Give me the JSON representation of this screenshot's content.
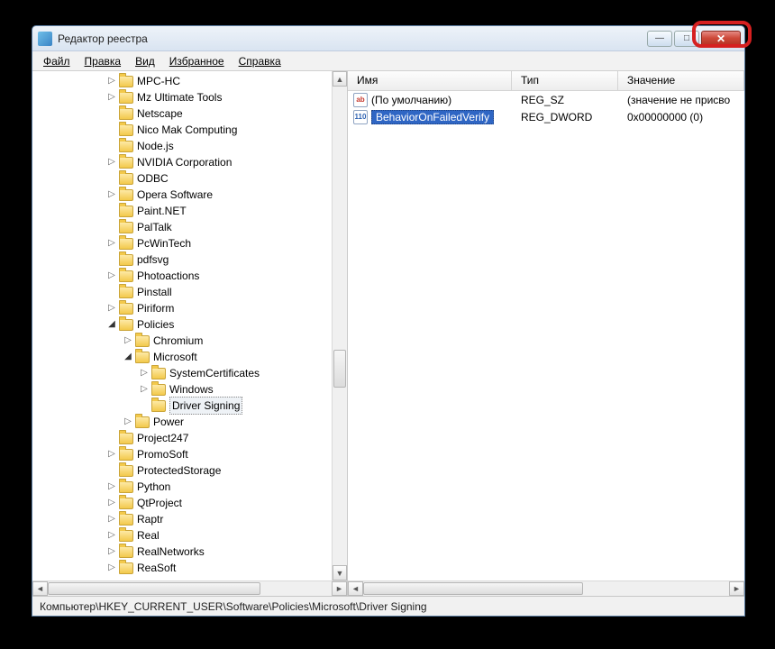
{
  "window": {
    "title": "Редактор реестра"
  },
  "menu": {
    "file": "Файл",
    "edit": "Правка",
    "view": "Вид",
    "favorites": "Избранное",
    "help": "Справка"
  },
  "tree": {
    "items": [
      {
        "depth": 0,
        "exp": "closed",
        "label": "MPC-HC"
      },
      {
        "depth": 0,
        "exp": "closed",
        "label": "Mz Ultimate Tools"
      },
      {
        "depth": 0,
        "exp": "none",
        "label": "Netscape"
      },
      {
        "depth": 0,
        "exp": "none",
        "label": "Nico Mak Computing"
      },
      {
        "depth": 0,
        "exp": "none",
        "label": "Node.js"
      },
      {
        "depth": 0,
        "exp": "closed",
        "label": "NVIDIA Corporation"
      },
      {
        "depth": 0,
        "exp": "none",
        "label": "ODBC"
      },
      {
        "depth": 0,
        "exp": "closed",
        "label": "Opera Software"
      },
      {
        "depth": 0,
        "exp": "none",
        "label": "Paint.NET"
      },
      {
        "depth": 0,
        "exp": "none",
        "label": "PalTalk"
      },
      {
        "depth": 0,
        "exp": "closed",
        "label": "PcWinTech"
      },
      {
        "depth": 0,
        "exp": "none",
        "label": "pdfsvg"
      },
      {
        "depth": 0,
        "exp": "closed",
        "label": "Photoactions"
      },
      {
        "depth": 0,
        "exp": "none",
        "label": "Pinstall"
      },
      {
        "depth": 0,
        "exp": "closed",
        "label": "Piriform"
      },
      {
        "depth": 0,
        "exp": "open",
        "label": "Policies"
      },
      {
        "depth": 1,
        "exp": "closed",
        "label": "Chromium"
      },
      {
        "depth": 1,
        "exp": "open",
        "label": "Microsoft"
      },
      {
        "depth": 2,
        "exp": "closed",
        "label": "SystemCertificates"
      },
      {
        "depth": 2,
        "exp": "closed",
        "label": "Windows"
      },
      {
        "depth": 2,
        "exp": "none",
        "label": "Driver Signing",
        "selected": true
      },
      {
        "depth": 1,
        "exp": "closed",
        "label": "Power"
      },
      {
        "depth": 0,
        "exp": "none",
        "label": "Project247"
      },
      {
        "depth": 0,
        "exp": "closed",
        "label": "PromoSoft"
      },
      {
        "depth": 0,
        "exp": "none",
        "label": "ProtectedStorage"
      },
      {
        "depth": 0,
        "exp": "closed",
        "label": "Python"
      },
      {
        "depth": 0,
        "exp": "closed",
        "label": "QtProject"
      },
      {
        "depth": 0,
        "exp": "closed",
        "label": "Raptr"
      },
      {
        "depth": 0,
        "exp": "closed",
        "label": "Real"
      },
      {
        "depth": 0,
        "exp": "closed",
        "label": "RealNetworks"
      },
      {
        "depth": 0,
        "exp": "closed",
        "label": "ReaSoft"
      }
    ]
  },
  "list": {
    "columns": {
      "name": "Имя",
      "type": "Тип",
      "value": "Значение"
    },
    "rows": [
      {
        "icon": "sz",
        "iconText": "ab",
        "name": "(По умолчанию)",
        "type": "REG_SZ",
        "value": "(значение не присво",
        "selected": false
      },
      {
        "icon": "dw",
        "iconText": "110",
        "name": "BehaviorOnFailedVerify",
        "type": "REG_DWORD",
        "value": "0x00000000 (0)",
        "selected": true
      }
    ]
  },
  "status": {
    "path": "Компьютер\\HKEY_CURRENT_USER\\Software\\Policies\\Microsoft\\Driver Signing"
  }
}
